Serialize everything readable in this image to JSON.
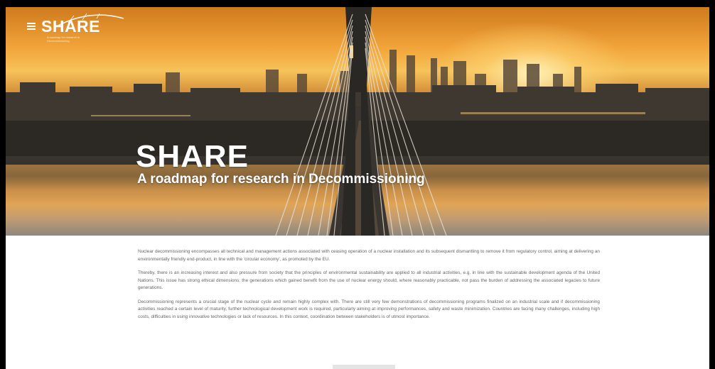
{
  "header": {
    "menu_icon": "hamburger-menu-icon",
    "logo_text": "SHARE",
    "logo_tagline": "A roadmap for research in Decommissioning"
  },
  "hero": {
    "title": "SHARE",
    "subtitle": "A roadmap for research in Decommissioning"
  },
  "content": {
    "paragraphs": [
      "Nuclear decommissioning encompasses all technical and management actions associated with ceasing operation of a nuclear installation and its subsequent dismantling to remove it from regulatory control, aiming at delivering an environmentally friendly end-product, in line with the 'circular economy', as promoted by the EU.",
      "Thereby, there is an increasing interest and also pressure from society that the principles of environmental sustainability are applied to all industrial activities, e.g. in line with the sustainable development agenda of the United Nations. This issue has strong ethical dimensions: the generations which gained benefit from the use of nuclear energy should, where reasonably practicable, not pass the burden of addressing the associated legacies to future generations.",
      "Decommissioning represents a crucial stage of the nuclear cycle and remain highly complex with. There are still very few demonstrations of decommissioning programs finalized on an industrial scale and if decommissioning activities reached a certain level of maturity, further technological development work is required, particularly aiming at improving performances, safety and waste minimization. Countries are facing many challenges, including high costs, difficulties in using innovative technologies or lack of resources. In this context, coordination between stakeholders is of utmost importance."
    ]
  },
  "colors": {
    "hero_text": "#ffffff",
    "body_text": "#666666",
    "page_background": "#ffffff",
    "outer_background": "#000000"
  }
}
